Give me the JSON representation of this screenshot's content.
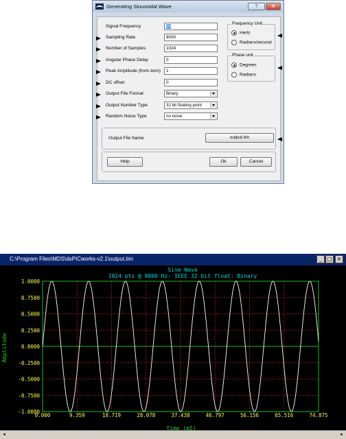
{
  "dialog": {
    "title": "Generating Sinusoidal Wave",
    "help_title_btn": "?",
    "close_title_btn": "✕",
    "fields": [
      {
        "label": "Signal Frequency",
        "value": "50",
        "arrow": false,
        "kind": "input"
      },
      {
        "label": "Sampling Rate",
        "value": "8000",
        "arrow": true,
        "kind": "input"
      },
      {
        "label": "Number of Samples",
        "value": "1024",
        "arrow": true,
        "kind": "input"
      },
      {
        "label": "Angular Phase Delay",
        "value": "0",
        "arrow": true,
        "kind": "input"
      },
      {
        "label": "Peak Amplitude (from zero)",
        "value": "1",
        "arrow": true,
        "kind": "input"
      },
      {
        "label": "DC offset",
        "value": "0",
        "arrow": true,
        "kind": "input"
      },
      {
        "label": "Output File Format",
        "value": "Binary",
        "arrow": true,
        "kind": "select"
      },
      {
        "label": "Output Number Type",
        "value": "32 bit floating point",
        "arrow": true,
        "kind": "select"
      },
      {
        "label": "Random Noise Type",
        "value": "no noise",
        "arrow": true,
        "kind": "select"
      }
    ],
    "frequency_unit": {
      "title": "Frequency Unit",
      "options": [
        {
          "label": "Hertz",
          "selected": true
        },
        {
          "label": "Radians/second",
          "selected": false
        }
      ]
    },
    "phase_unit": {
      "title": "Phase unit",
      "options": [
        {
          "label": "Degrees",
          "selected": true
        },
        {
          "label": "Radians",
          "selected": false
        }
      ]
    },
    "output_file_label": "Output File Name",
    "output_file_button": "output.tim",
    "help_button": "Help",
    "ok_button": "Ok",
    "cancel_button": "Cancel"
  },
  "plot_window": {
    "title": "C:\\Program Files\\MDS\\dsPICworks-v2.1\\output.tim",
    "minimize": "_",
    "maximize": "□",
    "close": "×",
    "scroll_left": "◂",
    "scroll_right": "▸"
  },
  "chart_data": {
    "type": "line",
    "title": "Sine Wave",
    "subtitle": "1024 pts @ 8000 Hz: IEEE 32 bit float: Binary",
    "xlabel": "Time (mS)",
    "ylabel": "Amplitude",
    "xlim": [
      0.0,
      74.875
    ],
    "ylim": [
      -1.0,
      1.0
    ],
    "x_ticks": [
      "0.000",
      "9.359",
      "18.719",
      "28.078",
      "37.438",
      "46.797",
      "56.156",
      "65.516",
      "74.875"
    ],
    "y_ticks": [
      "1.0000",
      "0.7500",
      "0.5000",
      "0.2500",
      "0.0000",
      "-0.2500",
      "-0.5000",
      "-0.7500",
      "-1.0000"
    ],
    "grid": true,
    "series": [
      {
        "frequency_hz": 100,
        "amplitude": 1.0,
        "phase_deg": 0,
        "offset": 0,
        "color": "#ffffff"
      }
    ],
    "colors": {
      "background": "#000000",
      "grid": "#c02020",
      "axis": "#20c020",
      "text": "#00dcdc",
      "ticks": "#ffff40",
      "trace": "#ffffff"
    }
  }
}
